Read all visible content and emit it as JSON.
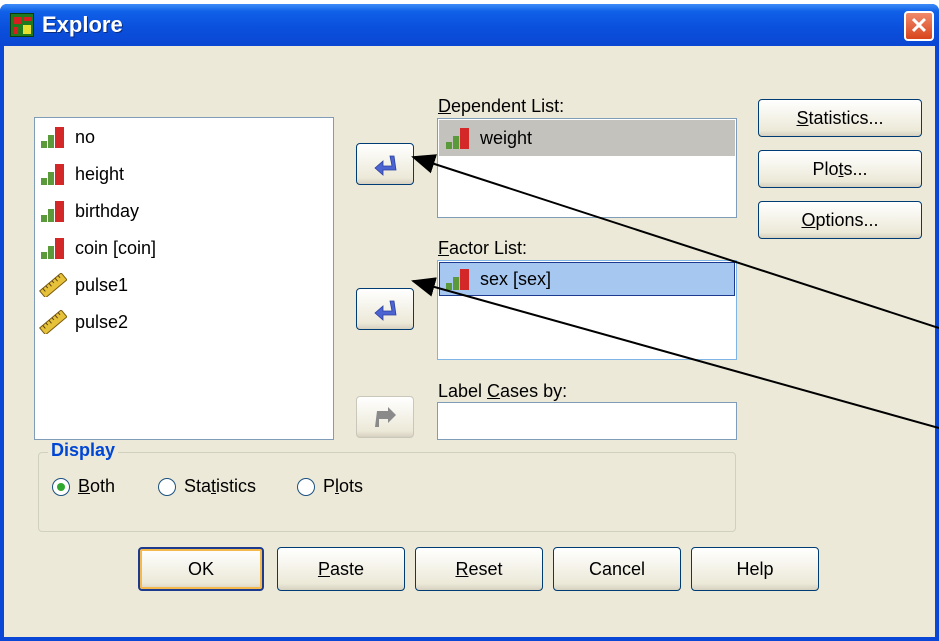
{
  "window": {
    "title": "Explore",
    "close_label": "✕"
  },
  "variables": {
    "items": [
      {
        "label": "no",
        "icon": "scale-icon"
      },
      {
        "label": "height",
        "icon": "scale-icon"
      },
      {
        "label": "birthday",
        "icon": "scale-icon"
      },
      {
        "label": "coin [coin]",
        "icon": "scale-icon"
      },
      {
        "label": "pulse1",
        "icon": "ruler-icon"
      },
      {
        "label": "pulse2",
        "icon": "ruler-icon"
      }
    ]
  },
  "dependent": {
    "label_pre": "",
    "label_key": "D",
    "label_post": "ependent List:",
    "items": [
      {
        "label": "weight",
        "icon": "scale-icon"
      }
    ]
  },
  "factor": {
    "label_pre": "",
    "label_key": "F",
    "label_post": "actor List:",
    "items": [
      {
        "label": "sex [sex]",
        "icon": "scale-icon"
      }
    ]
  },
  "label_cases": {
    "label_pre": "Label ",
    "label_key": "C",
    "label_post": "ases by:",
    "value": ""
  },
  "side_buttons": {
    "statistics": {
      "pre": "",
      "key": "S",
      "post": "tatistics..."
    },
    "plots": {
      "pre": "Plo",
      "key": "t",
      "post": "s..."
    },
    "options": {
      "pre": "",
      "key": "O",
      "post": "ptions..."
    }
  },
  "display": {
    "title": "Display",
    "both": {
      "pre": "",
      "key": "B",
      "post": "oth",
      "checked": true
    },
    "statistics": {
      "pre": "Sta",
      "key": "t",
      "post": "istics",
      "checked": false
    },
    "plots": {
      "pre": "P",
      "key": "l",
      "post": "ots",
      "checked": false
    }
  },
  "bottom_buttons": {
    "ok": {
      "pre": "OK",
      "key": "",
      "post": ""
    },
    "paste": {
      "pre": "",
      "key": "P",
      "post": "aste"
    },
    "reset": {
      "pre": "",
      "key": "R",
      "post": "eset"
    },
    "cancel": {
      "pre": "Cancel",
      "key": "",
      "post": ""
    },
    "help": {
      "pre": "Help",
      "key": "",
      "post": ""
    }
  },
  "colors": {
    "titlebar": "#0a4fdc",
    "dialog_bg": "#ece9d8",
    "selection_bg": "#a6c8f0",
    "arrow_blue": "#4b64d2",
    "display_title": "#0046d5"
  },
  "icons": {
    "scale-icon": "bar icon (scale variable)",
    "ruler-icon": "ruler icon (string variable)"
  }
}
